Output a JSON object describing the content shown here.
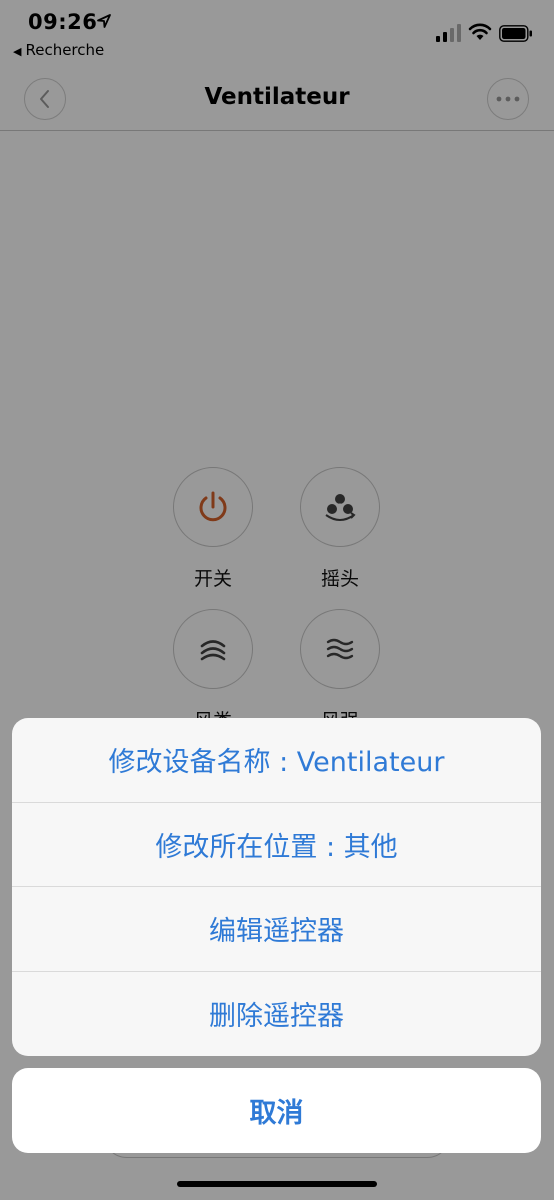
{
  "status_bar": {
    "time": "09:26",
    "back_app_label": "Recherche"
  },
  "nav": {
    "title": "Ventilateur"
  },
  "controls": [
    {
      "label": "开关",
      "icon": "power-icon"
    },
    {
      "label": "摇头",
      "icon": "fan-oscillate-icon"
    },
    {
      "label": "风类",
      "icon": "wind-mode-icon"
    },
    {
      "label": "风强",
      "icon": "wind-speed-icon"
    }
  ],
  "action_sheet": {
    "items": [
      "修改设备名称 : Ventilateur",
      "修改所在位置 : 其他",
      "编辑遥控器",
      "删除遥控器"
    ],
    "cancel": "取消"
  },
  "colors": {
    "accent": "#2f7ad6",
    "power": "#d6622b",
    "overlay": "rgba(0,0,0,0.40)"
  }
}
